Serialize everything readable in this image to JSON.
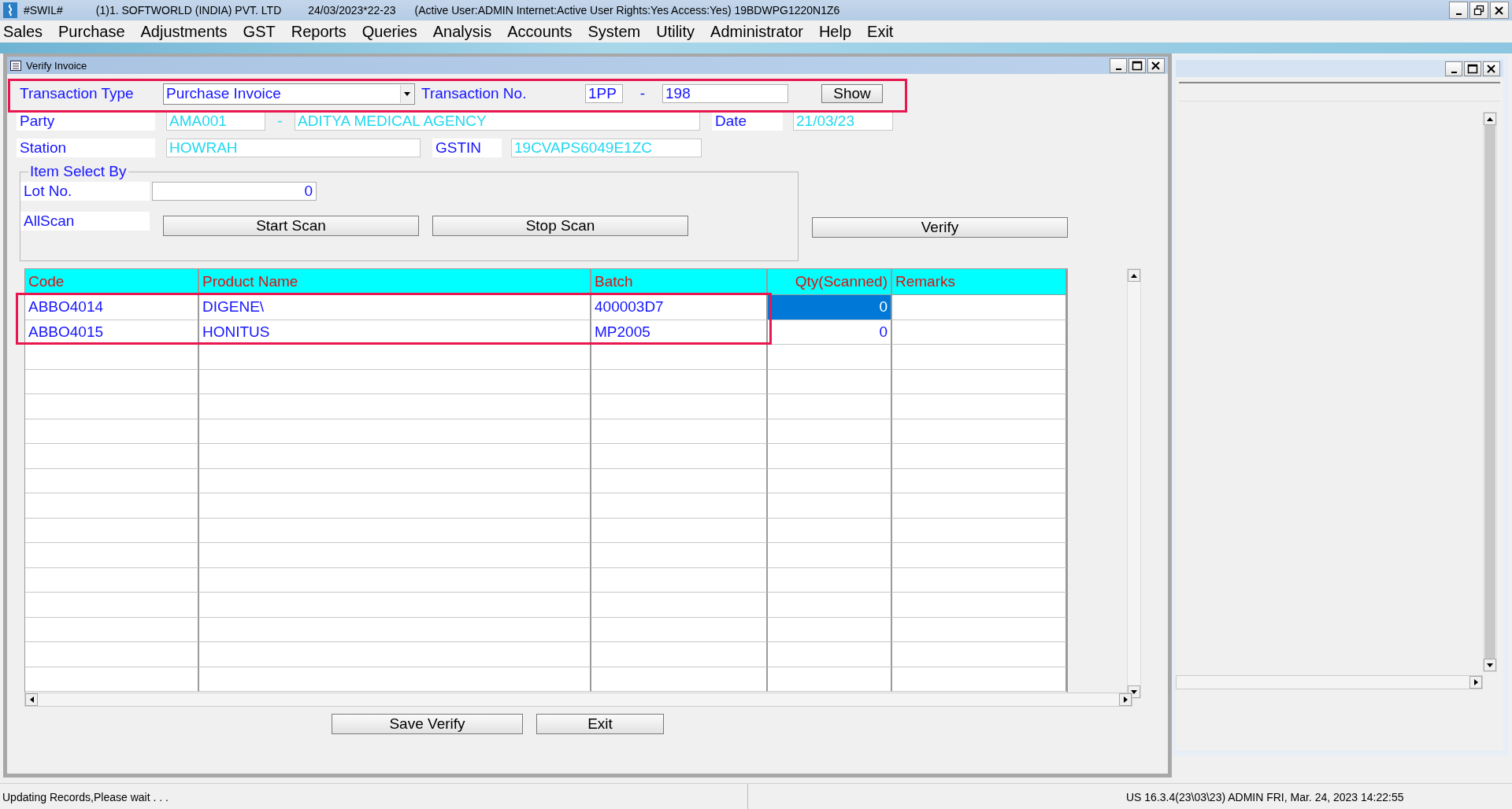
{
  "app_title_bar": {
    "app_name": "#SWIL#",
    "company": "(1)1. SOFTWORLD (INDIA) PVT. LTD",
    "date": "24/03/2023*22-23",
    "status": "(Active User:ADMIN Internet:Active  User Rights:Yes Access:Yes) 19BDWPG1220N1Z6"
  },
  "menu": [
    "Sales",
    "Purchase",
    "Adjustments",
    "GST",
    "Reports",
    "Queries",
    "Analysis",
    "Accounts",
    "System",
    "Utility",
    "Administrator",
    "Help",
    "Exit"
  ],
  "dialog": {
    "title": "Verify Invoice",
    "transaction_type": {
      "label": "Transaction Type",
      "value": "Purchase Invoice"
    },
    "transaction_no": {
      "label": "Transaction No.",
      "prefix": "1PP",
      "separator": "-",
      "number": "198"
    },
    "show_button": "Show",
    "party": {
      "label": "Party",
      "code": "AMA001",
      "separator": "-",
      "name": "ADITYA MEDICAL AGENCY"
    },
    "date": {
      "label": "Date",
      "value": "21/03/23"
    },
    "station": {
      "label": "Station",
      "value": "HOWRAH"
    },
    "gstin": {
      "label": "GSTIN",
      "value": "19CVAPS6049E1ZC"
    },
    "item_select": {
      "title": "Item Select By",
      "lot_label": "Lot No.",
      "lot_value": "0",
      "allscan_label": "AllScan",
      "buttons": [
        "Start Scan",
        "Stop Scan"
      ]
    },
    "verify_button": "Verify",
    "table": {
      "columns": [
        "Code",
        "Product Name",
        "Batch",
        "Qty(Scanned)",
        "Remarks"
      ],
      "rows": [
        {
          "code": "ABBO4014",
          "product_name": "DIGENE\\",
          "batch": "400003D7",
          "qty_scanned": "0",
          "selected": true
        },
        {
          "code": "ABBO4015",
          "product_name": "HONITUS",
          "batch": "MP2005",
          "qty_scanned": "0",
          "selected": false
        }
      ]
    },
    "buttons": [
      "Save Verify",
      "Exit"
    ]
  },
  "status_bar": {
    "message": "Updating Records,Please wait . . .",
    "info": "US 16.3.4(23\\03\\23) ADMIN  FRI, Mar. 24, 2023  14:22:55"
  }
}
